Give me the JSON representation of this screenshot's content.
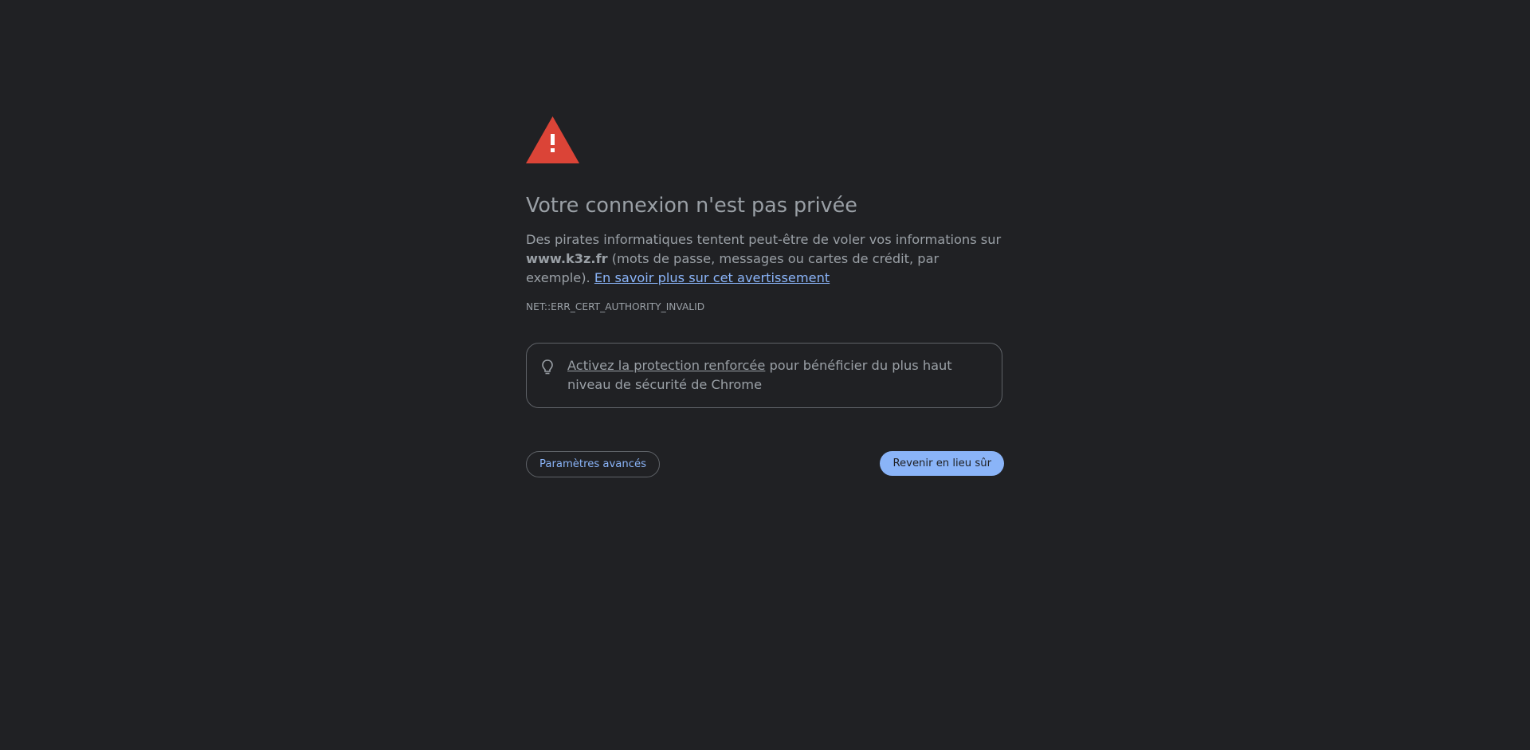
{
  "page": {
    "title": "Votre connexion n'est pas privée",
    "description_part1": "Des pirates informatiques tentent peut-être de voler vos informations sur ",
    "domain": "www.k3z.fr",
    "description_part2": " (mots de passe, messages ou cartes de crédit, par exemple). ",
    "learn_more_link": "En savoir plus sur cet avertissement",
    "error_code": "NET::ERR_CERT_AUTHORITY_INVALID"
  },
  "enhanced_protection": {
    "link_text": "Activez la protection renforcée",
    "text": " pour bénéficier du plus haut niveau de sécurité de Chrome"
  },
  "buttons": {
    "advanced_label": "Paramètres avancés",
    "back_label": "Revenir en lieu sûr"
  },
  "icons": {
    "warning": "warning-triangle-icon",
    "bulb": "lightbulb-icon"
  },
  "colors": {
    "background": "#202124",
    "text": "#9aa0a6",
    "link": "#8ab4f8",
    "warning_red": "#db4437",
    "primary_button": "#8ab4f8",
    "border": "#5f6368"
  }
}
